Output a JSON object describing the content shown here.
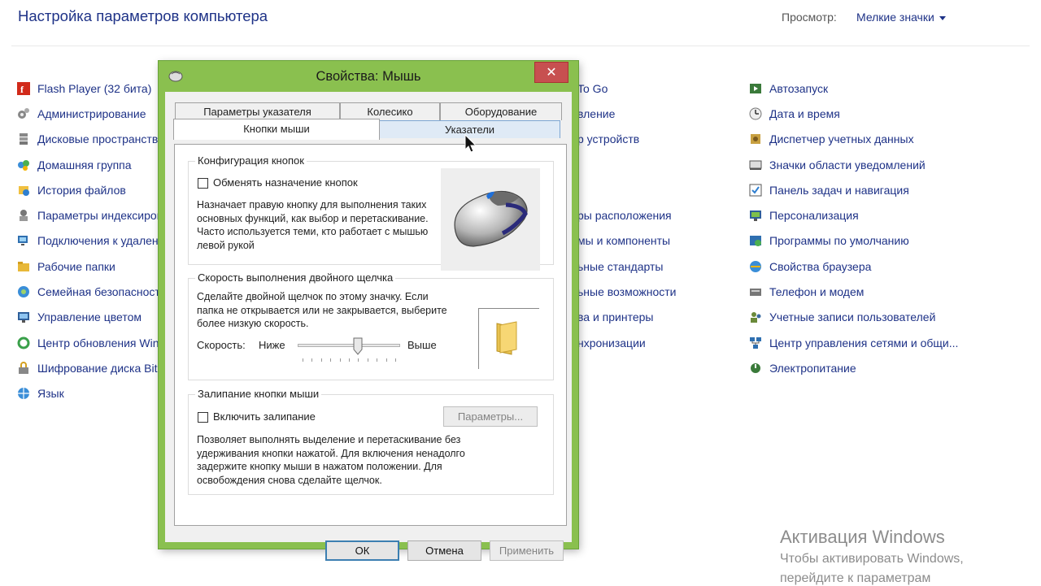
{
  "control_panel": {
    "title": "Настройка параметров компьютера",
    "view_label": "Просмотр:",
    "view_value": "Мелкие значки",
    "column1": [
      {
        "label": "Flash Player (32 бита)",
        "icon": "flash-icon"
      },
      {
        "label": "Администрирование",
        "icon": "admin-tools-icon"
      },
      {
        "label": "Дисковые пространства",
        "icon": "storage-spaces-icon"
      },
      {
        "label": "Домашняя группа",
        "icon": "homegroup-icon"
      },
      {
        "label": "История файлов",
        "icon": "file-history-icon"
      },
      {
        "label": "Параметры индексирования",
        "icon": "indexing-icon"
      },
      {
        "label": "Подключения к удаленным",
        "icon": "remote-connections-icon"
      },
      {
        "label": "Рабочие папки",
        "icon": "work-folders-icon"
      },
      {
        "label": "Семейная безопасность",
        "icon": "family-safety-icon"
      },
      {
        "label": "Управление цветом",
        "icon": "color-management-icon"
      },
      {
        "label": "Центр обновления Windows",
        "icon": "windows-update-icon"
      },
      {
        "label": "Шифрование диска BitLocker",
        "icon": "bitlocker-icon"
      },
      {
        "label": "Язык",
        "icon": "language-icon"
      }
    ],
    "column2": [
      {
        "label": "To Go"
      },
      {
        "label": "вление"
      },
      {
        "label": "р устройств"
      },
      {
        "label": ""
      },
      {
        "label": ""
      },
      {
        "label": "ры расположения"
      },
      {
        "label": "мы и компоненты"
      },
      {
        "label": "ьные стандарты"
      },
      {
        "label": "ьные возможности"
      },
      {
        "label": "ва и принтеры"
      },
      {
        "label": "нхронизации"
      }
    ],
    "column3": [
      {
        "label": "Автозапуск",
        "icon": "autoplay-icon"
      },
      {
        "label": "Дата и время",
        "icon": "date-time-icon"
      },
      {
        "label": "Диспетчер учетных данных",
        "icon": "credential-manager-icon"
      },
      {
        "label": "Значки области уведомлений",
        "icon": "notification-icons-icon"
      },
      {
        "label": "Панель задач и навигация",
        "icon": "taskbar-icon"
      },
      {
        "label": "Персонализация",
        "icon": "personalization-icon"
      },
      {
        "label": "Программы по умолчанию",
        "icon": "default-programs-icon"
      },
      {
        "label": "Свойства браузера",
        "icon": "browser-properties-icon"
      },
      {
        "label": "Телефон и модем",
        "icon": "phone-modem-icon"
      },
      {
        "label": "Учетные записи пользователей",
        "icon": "user-accounts-icon"
      },
      {
        "label": "Центр управления сетями и общи...",
        "icon": "network-center-icon"
      },
      {
        "label": "Электропитание",
        "icon": "power-options-icon"
      }
    ]
  },
  "activation": {
    "title": "Активация Windows",
    "line1": "Чтобы активировать Windows,",
    "line2": "перейдите к параметрам"
  },
  "dialog": {
    "title": "Свойства: Мышь",
    "close": "✕",
    "tabs_back": [
      "Параметры указателя",
      "Колесико",
      "Оборудование"
    ],
    "tabs_front": [
      "Кнопки мыши",
      "Указатели"
    ],
    "buttons_group": {
      "title": "Конфигурация кнопок",
      "swap_label": "Обменять назначение кнопок",
      "desc": "Назначает правую кнопку для выполнения таких основных функций, как выбор и перетаскивание. Часто используется теми, кто работает с мышью левой рукой"
    },
    "dblclick_group": {
      "title": "Скорость выполнения двойного щелчка",
      "desc": "Сделайте двойной щелчок по этому значку. Если папка не открывается или не закрывается, выберите более низкую скорость.",
      "speed_label": "Скорость:",
      "slow_label": "Ниже",
      "fast_label": "Выше",
      "speed_value": 0.6
    },
    "clicklock_group": {
      "title": "Залипание кнопки мыши",
      "enable_label": "Включить залипание",
      "settings_button": "Параметры...",
      "desc": "Позволяет выполнять выделение и перетаскивание без удерживания кнопки нажатой. Для включения ненадолго задержите кнопку мыши в нажатом положении. Для освобождения снова сделайте щелчок."
    },
    "ok": "ОК",
    "cancel": "Отмена",
    "apply": "Применить"
  }
}
